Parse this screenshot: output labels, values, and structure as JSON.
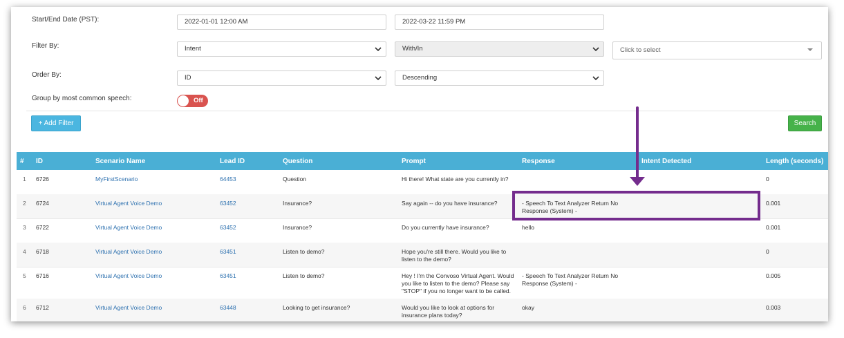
{
  "form": {
    "date_label": "Start/End Date (PST):",
    "start_date": "2022-01-01 12:00 AM",
    "end_date": "2022-03-22 11:59 PM",
    "filter_label": "Filter By:",
    "filter_field": "Intent",
    "filter_operator": "With/In",
    "filter_value_placeholder": "Click to select",
    "order_label": "Order By:",
    "order_field": "ID",
    "order_direction": "Descending",
    "group_label": "Group by most common speech:",
    "group_toggle": "Off",
    "add_filter": "+ Add Filter",
    "search": "Search"
  },
  "table": {
    "headers": [
      "#",
      "ID",
      "Scenario Name",
      "Lead ID",
      "Question",
      "Prompt",
      "Response",
      "Intent Detected",
      "Length (seconds)"
    ],
    "rows": [
      {
        "num": "1",
        "id": "6726",
        "scenario": "MyFirstScenario",
        "lead": "64453",
        "question": "Question",
        "prompt": "Hi there! What state are you currently in?",
        "response": "",
        "intent": "",
        "length": "0"
      },
      {
        "num": "2",
        "id": "6724",
        "scenario": "Virtual Agent Voice Demo",
        "lead": "63452",
        "question": "Insurance?",
        "prompt": "Say again -- do you have insurance?",
        "response": "- Speech To Text Analyzer Return No Response (System) -",
        "intent": "",
        "length": "0.001"
      },
      {
        "num": "3",
        "id": "6722",
        "scenario": "Virtual Agent Voice Demo",
        "lead": "63452",
        "question": "Insurance?",
        "prompt": "Do you currently have insurance?",
        "response": "hello",
        "intent": "",
        "length": "0.001"
      },
      {
        "num": "4",
        "id": "6718",
        "scenario": "Virtual Agent Voice Demo",
        "lead": "63451",
        "question": "Listen to demo?",
        "prompt": "Hope you're still there. Would you like to listen to the demo?",
        "response": "",
        "intent": "",
        "length": "0"
      },
      {
        "num": "5",
        "id": "6716",
        "scenario": "Virtual Agent Voice Demo",
        "lead": "63451",
        "question": "Listen to demo?",
        "prompt": "Hey ! I'm the Convoso Virtual Agent. Would you like to listen to the demo? Please say \"STOP\" if you no longer want to be called.",
        "response": "- Speech To Text Analyzer Return No Response (System) -",
        "intent": "",
        "length": "0.005"
      },
      {
        "num": "6",
        "id": "6712",
        "scenario": "Virtual Agent Voice Demo",
        "lead": "63448",
        "question": "Looking to get insurance?",
        "prompt": "Would you like to look at options for insurance plans today?",
        "response": "okay",
        "intent": "",
        "length": "0.003"
      }
    ]
  },
  "colors": {
    "header_bg": "#4aafd5",
    "annotation": "#742c8d",
    "link": "#2f72b0",
    "toggle_off": "#d9534f",
    "search_btn": "#46b24a",
    "add_filter_btn": "#4bb6e0"
  }
}
